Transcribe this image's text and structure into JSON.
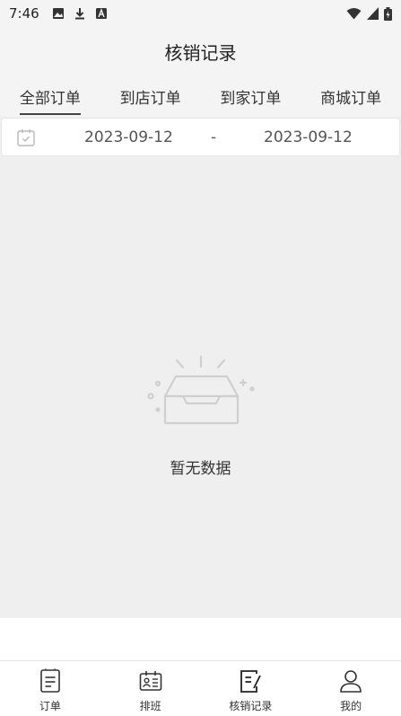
{
  "status_bar": {
    "time": "7:46",
    "left_icons": [
      "image-icon",
      "download-icon",
      "a-icon"
    ],
    "right_icons": [
      "wifi-icon",
      "signal-icon",
      "battery-icon"
    ]
  },
  "header": {
    "title": "核销记录"
  },
  "tabs": [
    {
      "label": "全部订单",
      "active": true
    },
    {
      "label": "到店订单",
      "active": false
    },
    {
      "label": "到家订单",
      "active": false
    },
    {
      "label": "商城订单",
      "active": false
    }
  ],
  "date_filter": {
    "icon": "calendar-icon",
    "start": "2023-09-12",
    "separator": "-",
    "end": "2023-09-12"
  },
  "empty_state": {
    "icon": "empty-box-icon",
    "text": "暂无数据"
  },
  "bottom_nav": [
    {
      "label": "订单",
      "icon": "order-icon",
      "active": false
    },
    {
      "label": "排班",
      "icon": "schedule-icon",
      "active": false
    },
    {
      "label": "核销记录",
      "icon": "writeoff-icon",
      "active": true
    },
    {
      "label": "我的",
      "icon": "profile-icon",
      "active": false
    }
  ]
}
